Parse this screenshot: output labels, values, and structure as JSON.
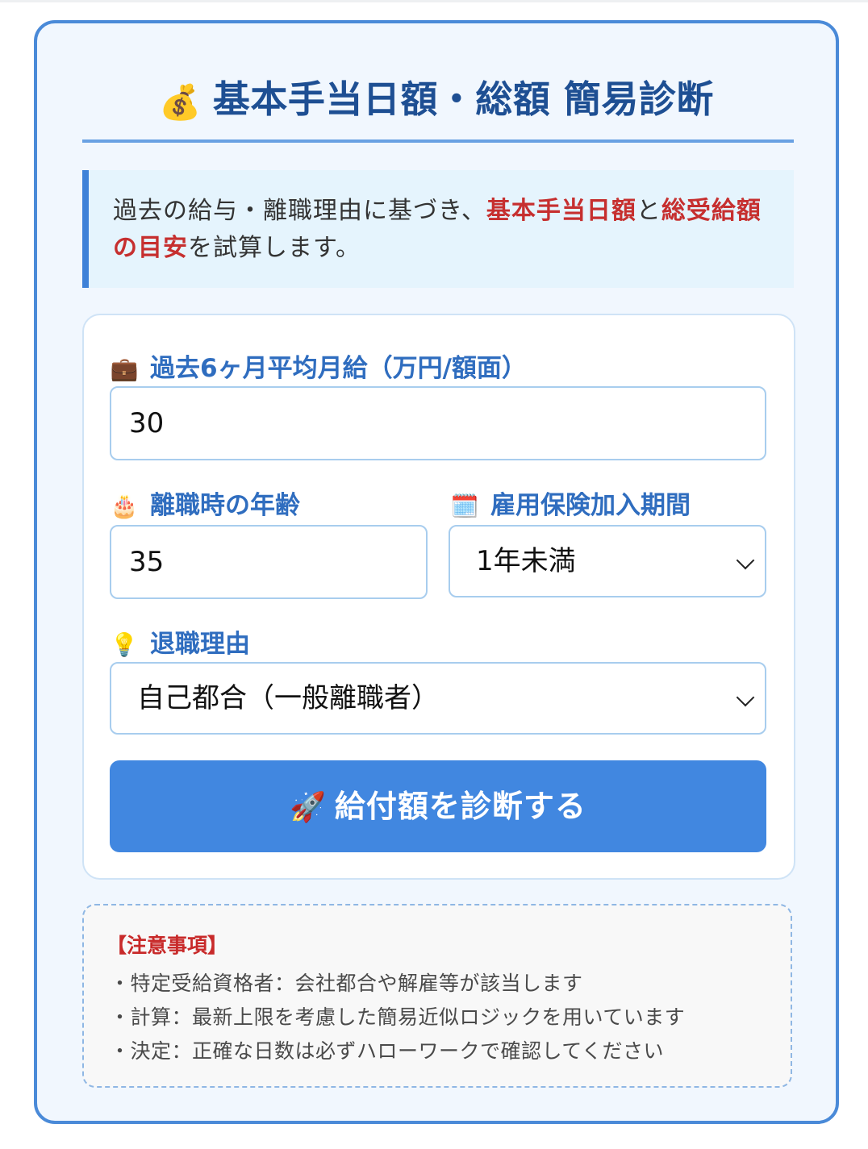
{
  "header": {
    "icon": "money-bag-icon",
    "title_emoji": "💰",
    "title": "基本手当日額・総額 簡易診断"
  },
  "intro": {
    "part1": "過去の給与・離職理由に基づき、",
    "highlight1": "基本手当日額",
    "part2": "と",
    "highlight2": "総受給額の目安",
    "part3": "を試算します。"
  },
  "form": {
    "salary": {
      "icon_glyph": "💼",
      "label": "過去6ヶ月平均月給（万円/額面）",
      "value": "30"
    },
    "age": {
      "icon_glyph": "🎂",
      "label": "離職時の年齢",
      "value": "35"
    },
    "period": {
      "icon_glyph": "🗓️",
      "label": "雇用保険加入期間",
      "selected": "1年未満"
    },
    "reason": {
      "icon_glyph": "💡",
      "label": "退職理由",
      "selected": "自己都合（一般離職者）"
    },
    "submit": {
      "icon_glyph": "🚀",
      "label": "給付額を診断する"
    }
  },
  "notes": {
    "title": "【注意事項】",
    "items": [
      "・特定受給資格者：会社都合や解雇等が該当します",
      "・計算：最新上限を考慮した簡易近似ロジックを用いています",
      "・決定：正確な日数は必ずハローワークで確認してください"
    ]
  },
  "colors": {
    "accent": "#4187e0",
    "title": "#1e4f93",
    "label": "#2f6dbf",
    "highlight": "#c62f2f"
  }
}
